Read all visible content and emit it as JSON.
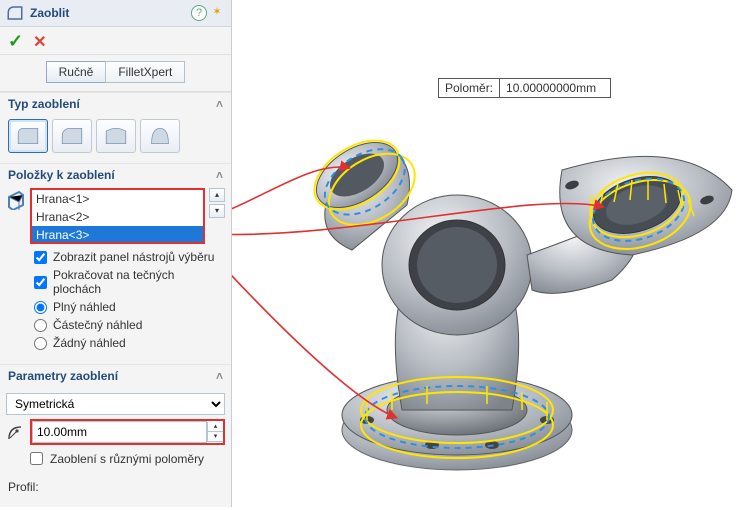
{
  "feature": {
    "title": "Zaoblit",
    "mode_tabs": {
      "manual": "Ručně",
      "xpert": "FilletXpert"
    }
  },
  "sections": {
    "type": "Typ zaoblení",
    "items": "Položky k zaoblení",
    "params": "Parametry zaoblení"
  },
  "items": {
    "rows": [
      "Hrana<1>",
      "Hrana<2>",
      "Hrana<3>"
    ],
    "selected_index": 2
  },
  "options": {
    "show_toolbar": "Zobrazit panel nástrojů výběru",
    "tangent": "Pokračovat na tečných plochách",
    "preview_full": "Plný náhled",
    "preview_partial": "Částečný náhled",
    "preview_none": "Žádný náhled"
  },
  "params": {
    "profile_type": "Symetrická",
    "radius_value": "10.00mm",
    "multi_radius_label": "Zaoblení s různými poloměry",
    "profile_label": "Profil:"
  },
  "callout": {
    "label": "Poloměr:",
    "value": "10.00000000mm"
  },
  "colors": {
    "highlight_red": "#e03030",
    "select_blue": "#1e78d7"
  }
}
